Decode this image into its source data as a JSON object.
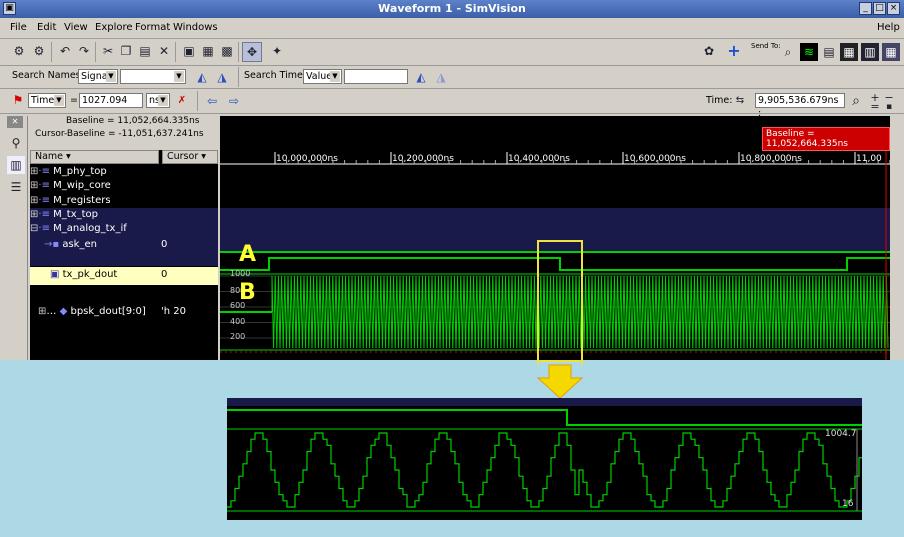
{
  "window": {
    "title": "Waveform 1 - SimVision"
  },
  "menu": [
    "File",
    "Edit",
    "View",
    "Explore",
    "Format",
    "Windows"
  ],
  "menu_help": "Help",
  "toolbar": {
    "send_to_label": "Send To:"
  },
  "search": {
    "names_label": "Search Names:",
    "names_type": "Signal",
    "names_value": "",
    "times_label": "Search Times:",
    "times_type": "Value",
    "times_value": ""
  },
  "cursorbar": {
    "cursor_name": "TimeA",
    "eq": "=",
    "cursor_value": "1027.094",
    "unit": "ns",
    "time_label": "Time:",
    "time_value": "9,905,536.679ns :"
  },
  "info": {
    "baseline": "Baseline = 11,052,664.335ns",
    "cursor_baseline": "Cursor-Baseline = -11,051,637.241ns"
  },
  "columns": {
    "name": "Name",
    "cursor": "Cursor"
  },
  "signals": [
    {
      "name": "M_phy_top",
      "value": ""
    },
    {
      "name": "M_wip_core",
      "value": ""
    },
    {
      "name": "M_registers",
      "value": ""
    },
    {
      "name": "M_tx_top",
      "value": ""
    },
    {
      "name": "M_analog_tx_if",
      "value": ""
    },
    {
      "name": "ask_en",
      "value": "0"
    },
    {
      "name": "tx_pk_dout",
      "value": "0"
    },
    {
      "name": "bpsk_dout[9:0]",
      "value": "'h 20"
    }
  ],
  "timeline": {
    "ticks": [
      "10,000,000ns",
      "10,200,000ns",
      "10,400,000ns",
      "10,600,000ns",
      "10,800,000ns",
      "11,00"
    ],
    "baseline_tag": "Baseline = 11,052,664.335ns"
  },
  "analog_axis": [
    "1000",
    "800",
    "600",
    "400",
    "200"
  ],
  "annotations": {
    "a": "A",
    "b": "B"
  },
  "zoom": {
    "max_label": "1004.7",
    "min_label": "16"
  },
  "colors": {
    "wave": "#00d000",
    "highlight": "#ffff66",
    "baseline": "#e00000",
    "callout": "#f0e040"
  }
}
